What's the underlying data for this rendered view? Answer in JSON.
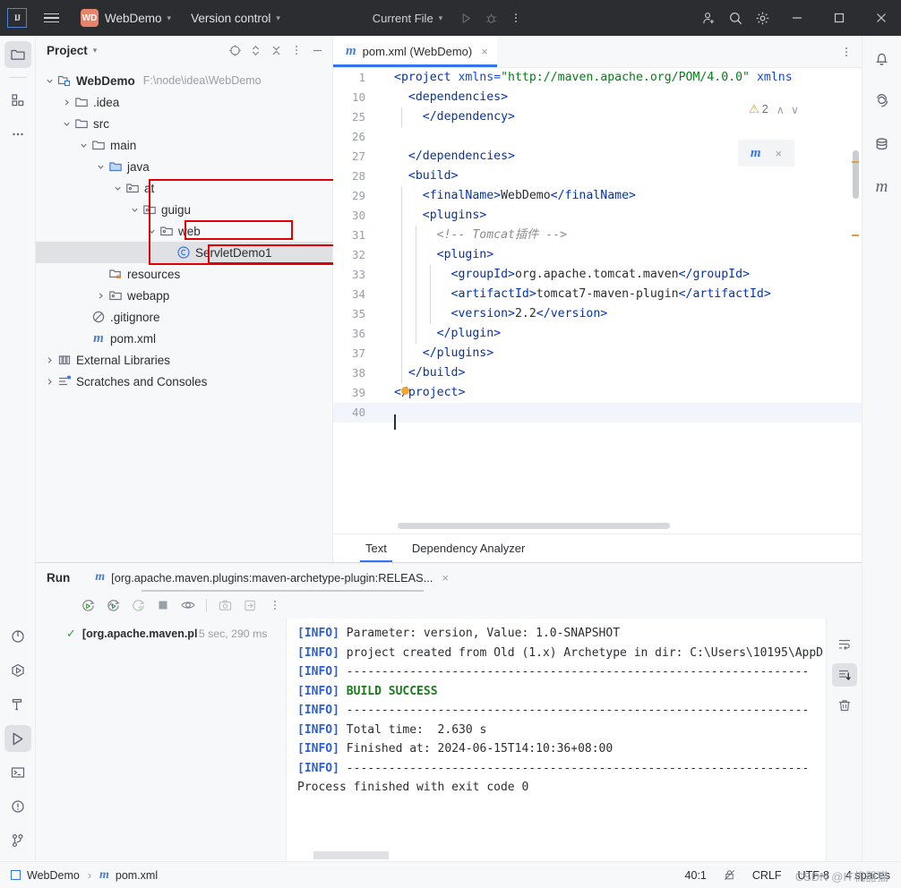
{
  "titlebar": {
    "logo": "IJ",
    "project_badge": "WD",
    "project_name": "WebDemo",
    "version_control": "Version control",
    "run_config": "Current File",
    "icons": {
      "menu": "hamburger-icon",
      "run": "run-icon",
      "debug": "debug-icon",
      "more": "more-vertical-icon",
      "add_user": "add-user-icon",
      "search": "search-icon",
      "settings": "gear-icon",
      "minimize": "minimize-icon",
      "maximize": "maximize-icon",
      "close": "close-icon"
    }
  },
  "left_strip": {
    "items": [
      {
        "name": "project-tool-icon",
        "active": true
      },
      {
        "name": "commit-tool-icon",
        "active": false
      },
      {
        "name": "more-tools-icon",
        "active": false
      },
      {
        "name": "profiler-icon",
        "active": false
      },
      {
        "name": "services-icon",
        "active": false
      },
      {
        "name": "build-icon",
        "active": false
      },
      {
        "name": "run-tool-icon",
        "active": true
      },
      {
        "name": "terminal-icon",
        "active": false
      },
      {
        "name": "problems-icon",
        "active": false
      },
      {
        "name": "version-control-icon",
        "active": false
      }
    ]
  },
  "right_strip": {
    "items": [
      {
        "name": "notifications-icon"
      },
      {
        "name": "ai-assistant-icon"
      },
      {
        "name": "database-icon"
      },
      {
        "name": "maven-icon"
      }
    ]
  },
  "project_panel": {
    "title": "Project",
    "actions": [
      "select-opened-file-icon",
      "expand-collapse-icon",
      "collapse-all-icon",
      "options-icon",
      "hide-icon"
    ],
    "tree": [
      {
        "label": "WebDemo",
        "path": "F:\\node\\idea\\WebDemo",
        "indent": 0,
        "arrow": "down",
        "icon": "module-icon",
        "bold": true,
        "selected": false
      },
      {
        "label": ".idea",
        "path": "",
        "indent": 1,
        "arrow": "right",
        "icon": "folder-icon",
        "bold": false,
        "selected": false
      },
      {
        "label": "src",
        "path": "",
        "indent": 1,
        "arrow": "down",
        "icon": "folder-icon",
        "bold": false,
        "selected": false
      },
      {
        "label": "main",
        "path": "",
        "indent": 2,
        "arrow": "down",
        "icon": "folder-icon",
        "bold": false,
        "selected": false
      },
      {
        "label": "java",
        "path": "",
        "indent": 3,
        "arrow": "down",
        "icon": "source-root-icon",
        "bold": false,
        "selected": false
      },
      {
        "label": "at",
        "path": "",
        "indent": 4,
        "arrow": "down",
        "icon": "package-icon",
        "bold": false,
        "selected": false
      },
      {
        "label": "guigu",
        "path": "",
        "indent": 5,
        "arrow": "down",
        "icon": "package-icon",
        "bold": false,
        "selected": false
      },
      {
        "label": "web",
        "path": "",
        "indent": 6,
        "arrow": "down",
        "icon": "package-icon",
        "bold": false,
        "selected": false
      },
      {
        "label": "ServletDemo1",
        "path": "",
        "indent": 7,
        "arrow": "none",
        "icon": "class-icon",
        "bold": false,
        "selected": true
      },
      {
        "label": "resources",
        "path": "",
        "indent": 3,
        "arrow": "none",
        "icon": "resources-root-icon",
        "bold": false,
        "selected": false
      },
      {
        "label": "webapp",
        "path": "",
        "indent": 3,
        "arrow": "right",
        "icon": "package-icon",
        "bold": false,
        "selected": false
      },
      {
        "label": ".gitignore",
        "path": "",
        "indent": 2,
        "arrow": "none",
        "icon": "gitignore-icon",
        "bold": false,
        "selected": false
      },
      {
        "label": "pom.xml",
        "path": "",
        "indent": 2,
        "arrow": "none",
        "icon": "maven-file-icon",
        "bold": false,
        "selected": false
      },
      {
        "label": "External Libraries",
        "path": "",
        "indent": 0,
        "arrow": "right",
        "icon": "library-icon",
        "bold": false,
        "selected": false
      },
      {
        "label": "Scratches and Consoles",
        "path": "",
        "indent": 0,
        "arrow": "right",
        "icon": "scratches-icon",
        "bold": false,
        "selected": false
      }
    ]
  },
  "editor": {
    "tab": {
      "label": "pom.xml (WebDemo)",
      "icon": "maven-file-icon",
      "close": "×"
    },
    "tabbar_more_icon": "more-vertical-icon",
    "inspections": {
      "count": "2",
      "icon": "warning-triangle-icon",
      "up": "∧",
      "down": "∨"
    },
    "maven_popup": {
      "reload_icon": "maven-reload-icon",
      "close": "×"
    },
    "lines": [
      {
        "num": "1",
        "indent": 0,
        "parts": [
          {
            "t": "<project ",
            "c": "tagb"
          },
          {
            "t": "xmlns=",
            "c": "attr"
          },
          {
            "t": "\"http://maven.apache.org/POM/4.0.0\"",
            "c": "val"
          },
          {
            "t": " xmlns",
            "c": "attr"
          }
        ]
      },
      {
        "num": "10",
        "indent": 0,
        "parts": [
          {
            "t": "  <dependencies>",
            "c": "tagb"
          }
        ]
      },
      {
        "num": "25",
        "indent": 1,
        "parts": [
          {
            "t": "    </dependency>",
            "c": "tagb"
          }
        ]
      },
      {
        "num": "26",
        "indent": 0,
        "parts": [
          {
            "t": "",
            "c": "txt"
          }
        ]
      },
      {
        "num": "27",
        "indent": 0,
        "parts": [
          {
            "t": "  </dependencies>",
            "c": "tagb"
          }
        ]
      },
      {
        "num": "28",
        "indent": 0,
        "parts": [
          {
            "t": "  <build>",
            "c": "tagb"
          }
        ]
      },
      {
        "num": "29",
        "indent": 1,
        "parts": [
          {
            "t": "    <finalName>",
            "c": "tagb"
          },
          {
            "t": "WebDemo",
            "c": "txt"
          },
          {
            "t": "</finalName>",
            "c": "tagb"
          }
        ]
      },
      {
        "num": "30",
        "indent": 1,
        "parts": [
          {
            "t": "    <plugins>",
            "c": "tagb"
          }
        ]
      },
      {
        "num": "31",
        "indent": 2,
        "parts": [
          {
            "t": "      <!-- Tomcat插件 -->",
            "c": "cmt"
          }
        ]
      },
      {
        "num": "32",
        "indent": 2,
        "parts": [
          {
            "t": "      <plugin>",
            "c": "tagb"
          }
        ]
      },
      {
        "num": "33",
        "indent": 3,
        "parts": [
          {
            "t": "        <groupId>",
            "c": "tagb"
          },
          {
            "t": "org.apache.tomcat.maven",
            "c": "txt"
          },
          {
            "t": "</groupId>",
            "c": "tagb"
          }
        ]
      },
      {
        "num": "34",
        "indent": 3,
        "parts": [
          {
            "t": "        <artifactId>",
            "c": "tagb"
          },
          {
            "t": "tomcat7-maven-plugin",
            "c": "txt"
          },
          {
            "t": "</artifactId>",
            "c": "tagb"
          }
        ]
      },
      {
        "num": "35",
        "indent": 3,
        "parts": [
          {
            "t": "        <version>",
            "c": "tagb"
          },
          {
            "t": "2.2",
            "c": "txt"
          },
          {
            "t": "</version>",
            "c": "tagb"
          }
        ]
      },
      {
        "num": "36",
        "indent": 2,
        "parts": [
          {
            "t": "      </plugin>",
            "c": "tagb"
          }
        ]
      },
      {
        "num": "37",
        "indent": 1,
        "parts": [
          {
            "t": "    </plugins>",
            "c": "tagb"
          }
        ]
      },
      {
        "num": "38",
        "indent": 1,
        "parts": [
          {
            "t": "  </build>",
            "c": "tagb"
          }
        ]
      },
      {
        "num": "39",
        "indent": 0,
        "parts": [
          {
            "t": "</project>",
            "c": "tagb"
          }
        ]
      },
      {
        "num": "40",
        "indent": 0,
        "parts": [
          {
            "t": "",
            "c": "txt"
          }
        ]
      }
    ],
    "bottom_tabs": [
      {
        "label": "Text",
        "active": true
      },
      {
        "label": "Dependency Analyzer",
        "active": false
      }
    ]
  },
  "run_panel": {
    "title": "Run",
    "tab_label": "[org.apache.maven.plugins:maven-archetype-plugin:RELEAS...",
    "tab_icon": "maven-file-icon",
    "tab_close": "×",
    "toolbar": [
      "rerun-icon",
      "rerun-failed-icon",
      "rerun-auto-icon",
      "stop-icon",
      "eye-icon",
      "screenshot-icon",
      "export-icon",
      "more-vertical-icon"
    ],
    "tree_row": {
      "status": "✓",
      "name": "[org.apache.maven.plu",
      "time": "5 sec, 290 ms"
    },
    "console_lines": [
      {
        "prefix": "[INFO]",
        "text": " Parameter: version, Value: 1.0-SNAPSHOT",
        "style": "normal"
      },
      {
        "prefix": "[INFO]",
        "text": " project created from Old (1.x) Archetype in dir: C:\\Users\\10195\\AppD",
        "style": "normal"
      },
      {
        "prefix": "[INFO]",
        "text": " ------------------------------------------------------------------",
        "style": "normal"
      },
      {
        "prefix": "[INFO]",
        "text": " BUILD SUCCESS",
        "style": "green"
      },
      {
        "prefix": "[INFO]",
        "text": " ------------------------------------------------------------------",
        "style": "normal"
      },
      {
        "prefix": "[INFO]",
        "text": " Total time:  2.630 s",
        "style": "normal"
      },
      {
        "prefix": "[INFO]",
        "text": " Finished at: 2024-06-15T14:10:36+08:00",
        "style": "normal"
      },
      {
        "prefix": "[INFO]",
        "text": " ------------------------------------------------------------------",
        "style": "normal"
      },
      {
        "prefix": "",
        "text": "",
        "style": "normal"
      },
      {
        "prefix": "",
        "text": "Process finished with exit code 0",
        "style": "normal"
      }
    ],
    "side_tools": [
      {
        "name": "soft-wrap-icon",
        "active": false
      },
      {
        "name": "scroll-to-end-icon",
        "active": true
      },
      {
        "name": "clear-all-icon",
        "active": false
      }
    ]
  },
  "statusbar": {
    "crumb_project": "WebDemo",
    "crumb_sep": "›",
    "crumb_file": "pom.xml",
    "caret": "40:1",
    "line_sep": "CRLF",
    "encoding": "UTF-8",
    "indent": "4 spaces",
    "lock_icon": "read-only-toggle-icon",
    "watermark": "CSDN @IT机器猫"
  }
}
